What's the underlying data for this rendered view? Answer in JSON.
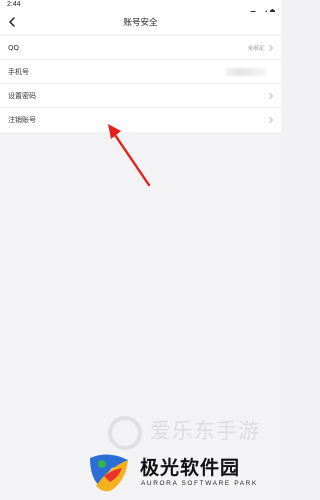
{
  "status_bar": {
    "time": "2:44",
    "icons": [
      "wifi-icon",
      "signal-icon",
      "battery-icon"
    ]
  },
  "nav": {
    "title": "账号安全",
    "back_icon": "back-arrow-icon"
  },
  "rows": [
    {
      "label": "QQ",
      "value": "未绑定"
    },
    {
      "label": "手机号",
      "value": ""
    },
    {
      "label": "设置密码",
      "value": ""
    },
    {
      "label": "注销账号",
      "value": ""
    }
  ],
  "watermark": {
    "text": "爱乐东手游"
  },
  "brand": {
    "name": "极光软件园",
    "subtitle": "AURORA SOFTWARE PARK"
  },
  "colors": {
    "arrow": "#e8201c",
    "background": "#f3f3f5",
    "card": "#ffffff"
  }
}
